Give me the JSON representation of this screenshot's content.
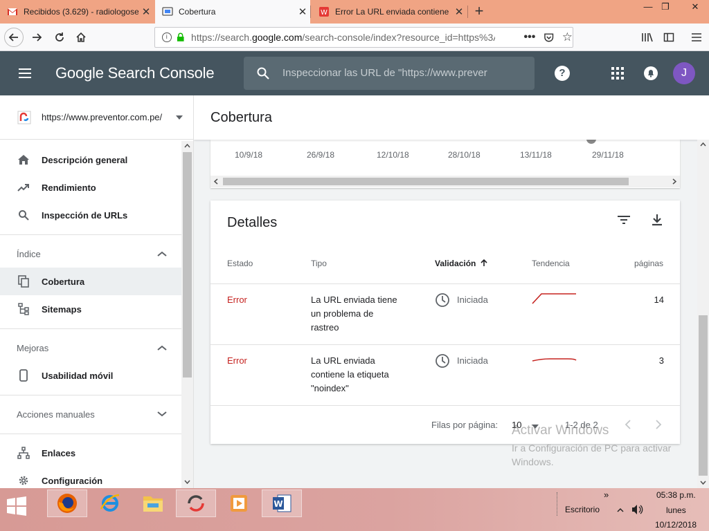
{
  "browser": {
    "tabs": [
      {
        "title": "Recibidos (3.629) - radiologoser",
        "icon": "gmail-icon"
      },
      {
        "title": "Cobertura",
        "icon": "search-console-icon"
      },
      {
        "title": "Error La URL enviada contiene l",
        "icon": "document-icon"
      }
    ],
    "url_prefix": "https://search.",
    "url_domain": "google.com",
    "url_rest": "/search-console/index?resource_id=https%3A"
  },
  "header": {
    "logo": "Google Search Console",
    "search_placeholder": "Inspeccionar las URL de \"https://www.prever",
    "avatar_letter": "J",
    "avatar_color": "#7e57c2"
  },
  "sidebar": {
    "property": "https://www.preventor.com.pe/",
    "items": {
      "overview": "Descripción general",
      "performance": "Rendimiento",
      "url_inspection": "Inspección de URLs",
      "coverage": "Cobertura",
      "sitemaps": "Sitemaps",
      "mobile": "Usabilidad móvil",
      "links": "Enlaces",
      "settings": "Configuración"
    },
    "sections": {
      "index": "Índice",
      "enhancements": "Mejoras",
      "manual_actions": "Acciones manuales"
    }
  },
  "main": {
    "page_title": "Cobertura",
    "chart_dates": [
      "10/9/18",
      "26/9/18",
      "12/10/18",
      "28/10/18",
      "13/11/18",
      "29/11/18"
    ],
    "details": {
      "title": "Detalles",
      "columns": {
        "status": "Estado",
        "type": "Tipo",
        "validation": "Validación",
        "trend": "Tendencia",
        "pages": "páginas"
      },
      "rows": [
        {
          "status": "Error",
          "type_l1": "La URL enviada tiene",
          "type_l2": "un problema de",
          "type_l3": "rastreo",
          "validation": "Iniciada",
          "pages": "14"
        },
        {
          "status": "Error",
          "type_l1": "La URL enviada",
          "type_l2": "contiene la etiqueta",
          "type_l3": "\"noindex\"",
          "validation": "Iniciada",
          "pages": "3"
        }
      ],
      "rows_per_page_label": "Filas por página:",
      "rows_per_page": "10",
      "range": "1-2 de 2"
    },
    "error_color": "#c5221f"
  },
  "watermark": {
    "line1": "Activar Windows",
    "line2": "Ir a Configuración de PC para activar Windows."
  },
  "taskbar": {
    "desktop_label": "Escritorio",
    "time": "05:38 p.m.",
    "day": "lunes",
    "date": "10/12/2018",
    "more": "»"
  }
}
